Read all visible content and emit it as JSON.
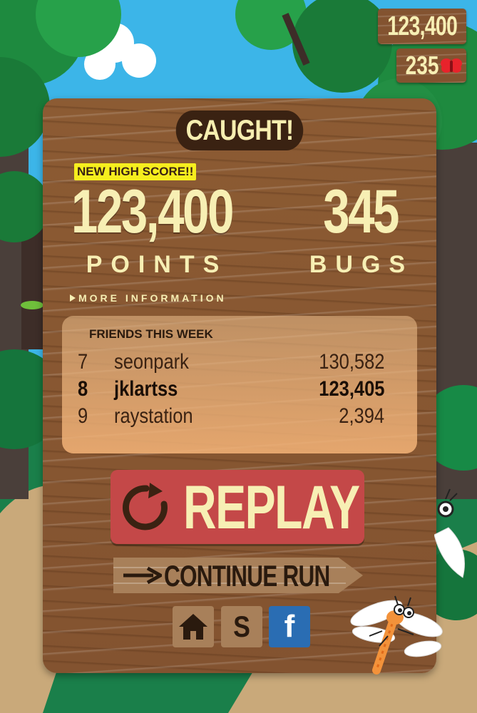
{
  "hud": {
    "score": "123,400",
    "bugs": "235",
    "bug_icon": "red-bug-icon"
  },
  "result": {
    "title": "CAUGHT!",
    "badge": "NEW HIGH SCORE!!",
    "points_value": "123,400",
    "points_label": "POINTS",
    "bugs_value": "345",
    "bugs_label": "BUGS",
    "more_info": "MORE INFORMATION"
  },
  "friends": {
    "title": "FRIENDS THIS WEEK",
    "rows": [
      {
        "rank": "7",
        "name": "seonpark",
        "score": "130,582"
      },
      {
        "rank": "8",
        "name": "jklartss",
        "score": "123,405"
      },
      {
        "rank": "9",
        "name": "raystation",
        "score": "2,394"
      }
    ]
  },
  "actions": {
    "replay": "REPLAY",
    "continue": "CONTINUE RUN",
    "shop_label": "S",
    "facebook_label": "f"
  },
  "colors": {
    "cream_text": "#f7efb4",
    "wood": "#835330",
    "replay_red": "#c44848",
    "badge_yellow": "#f6ee1e",
    "facebook_blue": "#2a6db3",
    "sky": "#3cb5e8"
  }
}
